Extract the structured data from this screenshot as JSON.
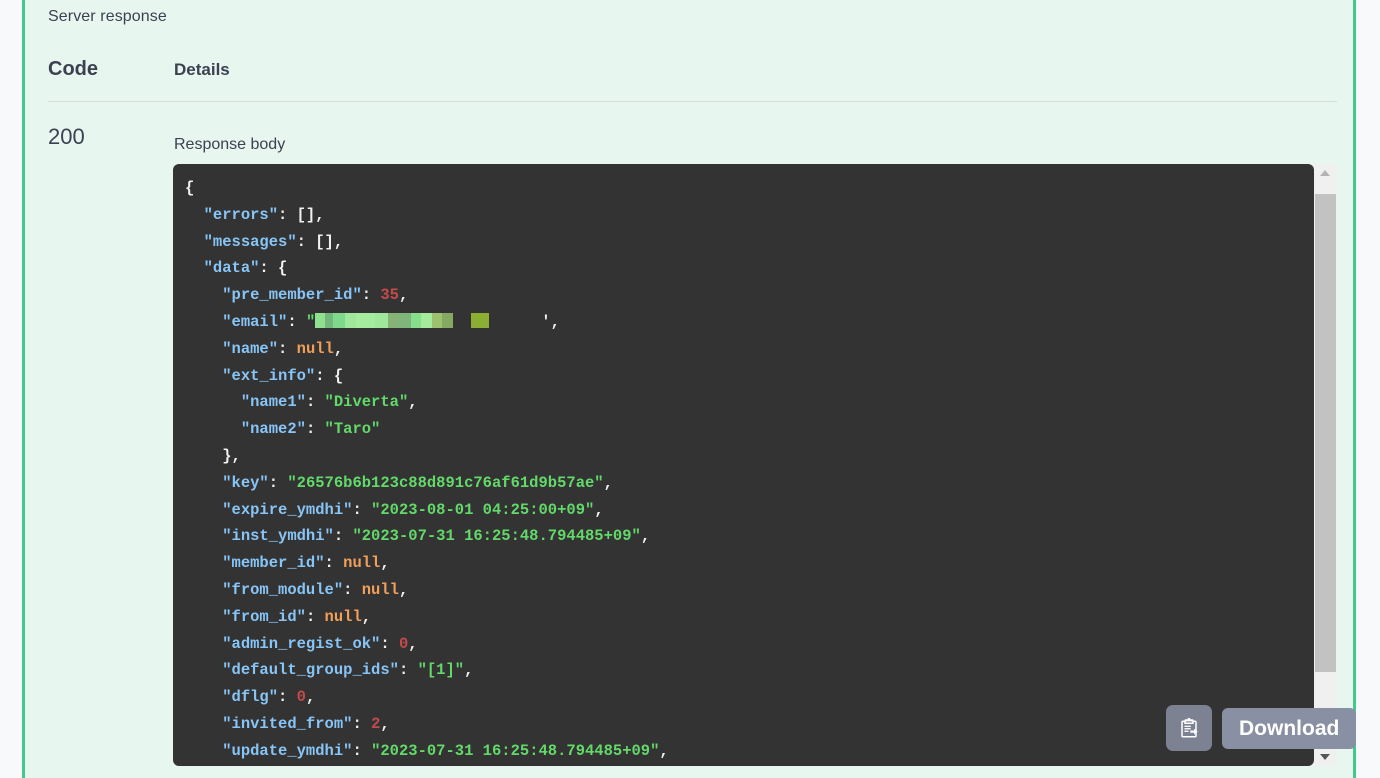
{
  "panel": {
    "server_response_label": "Server response",
    "accent_color": "#41c98e",
    "background_color": "#e8f6f0"
  },
  "table": {
    "header_code": "Code",
    "header_details": "Details",
    "status_code": "200",
    "response_body_label": "Response body"
  },
  "response_body": {
    "redacted_email_note": "email value redacted",
    "lines": [
      [
        {
          "t": "{",
          "c": "pun"
        }
      ],
      [
        {
          "t": "  ",
          "c": "pun"
        },
        {
          "t": "\"errors\"",
          "c": "key"
        },
        {
          "t": ": [],",
          "c": "pun"
        }
      ],
      [
        {
          "t": "  ",
          "c": "pun"
        },
        {
          "t": "\"messages\"",
          "c": "key"
        },
        {
          "t": ": [],",
          "c": "pun"
        }
      ],
      [
        {
          "t": "  ",
          "c": "pun"
        },
        {
          "t": "\"data\"",
          "c": "key"
        },
        {
          "t": ": {",
          "c": "pun"
        }
      ],
      [
        {
          "t": "    ",
          "c": "pun"
        },
        {
          "t": "\"pre_member_id\"",
          "c": "key"
        },
        {
          "t": ": ",
          "c": "pun"
        },
        {
          "t": "35",
          "c": "num"
        },
        {
          "t": ",",
          "c": "pun"
        }
      ],
      [
        {
          "t": "    ",
          "c": "pun"
        },
        {
          "t": "\"email\"",
          "c": "key"
        },
        {
          "t": ": ",
          "c": "pun"
        },
        {
          "t": "\"",
          "c": "str"
        },
        {
          "t": "",
          "c": "redact"
        },
        {
          "t": "',",
          "c": "pun"
        }
      ],
      [
        {
          "t": "    ",
          "c": "pun"
        },
        {
          "t": "\"name\"",
          "c": "key"
        },
        {
          "t": ": ",
          "c": "pun"
        },
        {
          "t": "null",
          "c": "null"
        },
        {
          "t": ",",
          "c": "pun"
        }
      ],
      [
        {
          "t": "    ",
          "c": "pun"
        },
        {
          "t": "\"ext_info\"",
          "c": "key"
        },
        {
          "t": ": {",
          "c": "pun"
        }
      ],
      [
        {
          "t": "      ",
          "c": "pun"
        },
        {
          "t": "\"name1\"",
          "c": "key"
        },
        {
          "t": ": ",
          "c": "pun"
        },
        {
          "t": "\"Diverta\"",
          "c": "str"
        },
        {
          "t": ",",
          "c": "pun"
        }
      ],
      [
        {
          "t": "      ",
          "c": "pun"
        },
        {
          "t": "\"name2\"",
          "c": "key"
        },
        {
          "t": ": ",
          "c": "pun"
        },
        {
          "t": "\"Taro\"",
          "c": "str"
        }
      ],
      [
        {
          "t": "    },",
          "c": "pun"
        }
      ],
      [
        {
          "t": "    ",
          "c": "pun"
        },
        {
          "t": "\"key\"",
          "c": "key"
        },
        {
          "t": ": ",
          "c": "pun"
        },
        {
          "t": "\"26576b6b123c88d891c76af61d9b57ae\"",
          "c": "str"
        },
        {
          "t": ",",
          "c": "pun"
        }
      ],
      [
        {
          "t": "    ",
          "c": "pun"
        },
        {
          "t": "\"expire_ymdhi\"",
          "c": "key"
        },
        {
          "t": ": ",
          "c": "pun"
        },
        {
          "t": "\"2023-08-01 04:25:00+09\"",
          "c": "str"
        },
        {
          "t": ",",
          "c": "pun"
        }
      ],
      [
        {
          "t": "    ",
          "c": "pun"
        },
        {
          "t": "\"inst_ymdhi\"",
          "c": "key"
        },
        {
          "t": ": ",
          "c": "pun"
        },
        {
          "t": "\"2023-07-31 16:25:48.794485+09\"",
          "c": "str"
        },
        {
          "t": ",",
          "c": "pun"
        }
      ],
      [
        {
          "t": "    ",
          "c": "pun"
        },
        {
          "t": "\"member_id\"",
          "c": "key"
        },
        {
          "t": ": ",
          "c": "pun"
        },
        {
          "t": "null",
          "c": "null"
        },
        {
          "t": ",",
          "c": "pun"
        }
      ],
      [
        {
          "t": "    ",
          "c": "pun"
        },
        {
          "t": "\"from_module\"",
          "c": "key"
        },
        {
          "t": ": ",
          "c": "pun"
        },
        {
          "t": "null",
          "c": "null"
        },
        {
          "t": ",",
          "c": "pun"
        }
      ],
      [
        {
          "t": "    ",
          "c": "pun"
        },
        {
          "t": "\"from_id\"",
          "c": "key"
        },
        {
          "t": ": ",
          "c": "pun"
        },
        {
          "t": "null",
          "c": "null"
        },
        {
          "t": ",",
          "c": "pun"
        }
      ],
      [
        {
          "t": "    ",
          "c": "pun"
        },
        {
          "t": "\"admin_regist_ok\"",
          "c": "key"
        },
        {
          "t": ": ",
          "c": "pun"
        },
        {
          "t": "0",
          "c": "num"
        },
        {
          "t": ",",
          "c": "pun"
        }
      ],
      [
        {
          "t": "    ",
          "c": "pun"
        },
        {
          "t": "\"default_group_ids\"",
          "c": "key"
        },
        {
          "t": ": ",
          "c": "pun"
        },
        {
          "t": "\"[1]\"",
          "c": "str"
        },
        {
          "t": ",",
          "c": "pun"
        }
      ],
      [
        {
          "t": "    ",
          "c": "pun"
        },
        {
          "t": "\"dflg\"",
          "c": "key"
        },
        {
          "t": ": ",
          "c": "pun"
        },
        {
          "t": "0",
          "c": "num"
        },
        {
          "t": ",",
          "c": "pun"
        }
      ],
      [
        {
          "t": "    ",
          "c": "pun"
        },
        {
          "t": "\"invited_from\"",
          "c": "key"
        },
        {
          "t": ": ",
          "c": "pun"
        },
        {
          "t": "2",
          "c": "num"
        },
        {
          "t": ",",
          "c": "pun"
        }
      ],
      [
        {
          "t": "    ",
          "c": "pun"
        },
        {
          "t": "\"update_ymdhi\"",
          "c": "key"
        },
        {
          "t": ": ",
          "c": "pun"
        },
        {
          "t": "\"2023-07-31 16:25:48.794485+09\"",
          "c": "str"
        },
        {
          "t": ",",
          "c": "pun"
        }
      ]
    ],
    "redaction_blocks": [
      {
        "w": 10,
        "color": "#8fe08f"
      },
      {
        "w": 8,
        "color": "#74b77a"
      },
      {
        "w": 12,
        "color": "#7fd98c"
      },
      {
        "w": 11,
        "color": "#9fe89b"
      },
      {
        "w": 19,
        "color": "#a6ec9e"
      },
      {
        "w": 13,
        "color": "#9fe89b"
      },
      {
        "w": 10,
        "color": "#86b177"
      },
      {
        "w": 13,
        "color": "#7fb57b"
      },
      {
        "w": 10,
        "color": "#86e08b"
      },
      {
        "w": 11,
        "color": "#a4eb9e"
      },
      {
        "w": 10,
        "color": "#9cc16f"
      },
      {
        "w": 11,
        "color": "#86a962"
      },
      {
        "w": 18,
        "color": "transparent"
      },
      {
        "w": 18,
        "color": "#8cae33"
      },
      {
        "w": 52,
        "color": "transparent"
      }
    ]
  },
  "actions": {
    "copy_icon": "clipboard-copy-icon",
    "download_label": "Download"
  },
  "scrollbar": {
    "up_icon": "scroll-up-arrow-icon",
    "down_icon": "scroll-down-arrow-icon"
  }
}
